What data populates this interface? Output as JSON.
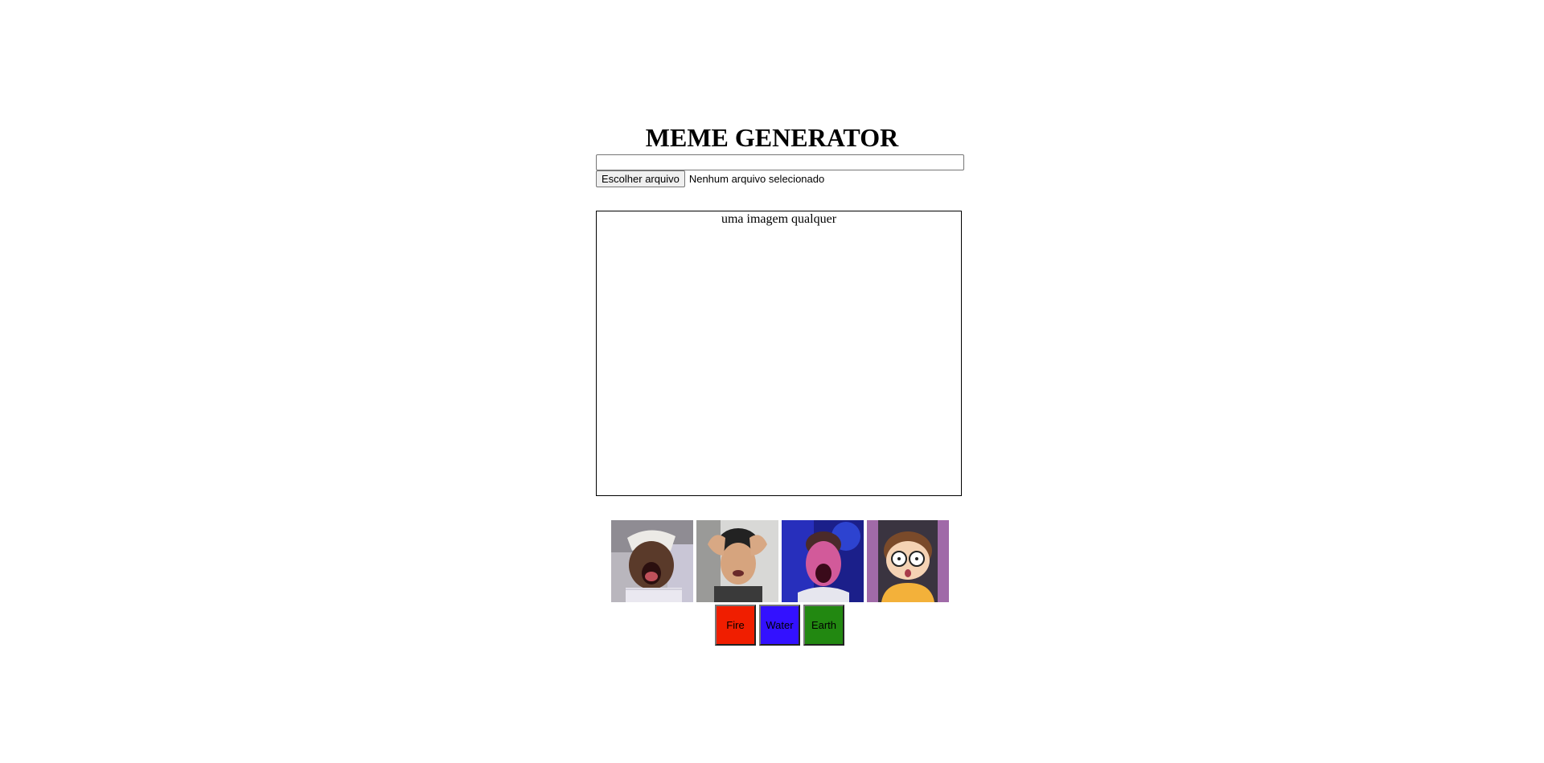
{
  "page": {
    "title": "MEME GENERATOR"
  },
  "text_input": {
    "value": "",
    "placeholder": ""
  },
  "file_input": {
    "button_label": "Escolher arquivo",
    "status": "Nenhum arquivo selecionado"
  },
  "meme": {
    "image_alt": "uma imagem qualquer"
  },
  "thumbnails": [
    {
      "icon": "meme-thumbnail-laughing-man"
    },
    {
      "icon": "meme-thumbnail-confused-man"
    },
    {
      "icon": "meme-thumbnail-shouting-man"
    },
    {
      "icon": "meme-thumbnail-cartoon-kid"
    }
  ],
  "border_buttons": [
    {
      "label": "Fire",
      "color": "#f01e00"
    },
    {
      "label": "Water",
      "color": "#3311ff"
    },
    {
      "label": "Earth",
      "color": "#228811"
    }
  ]
}
